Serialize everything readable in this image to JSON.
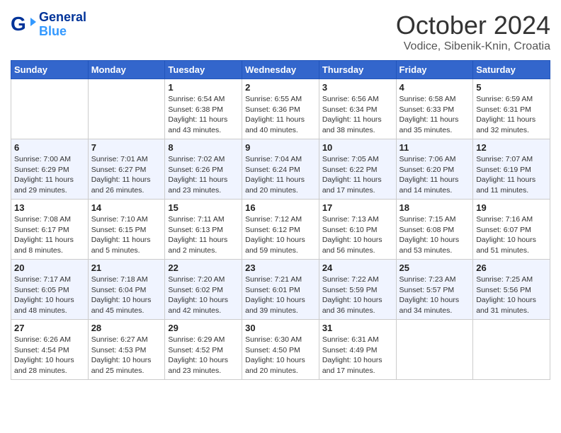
{
  "header": {
    "logo_line1": "General",
    "logo_line2": "Blue",
    "month": "October 2024",
    "location": "Vodice, Sibenik-Knin, Croatia"
  },
  "days_of_week": [
    "Sunday",
    "Monday",
    "Tuesday",
    "Wednesday",
    "Thursday",
    "Friday",
    "Saturday"
  ],
  "weeks": [
    [
      {
        "day": "",
        "sunrise": "",
        "sunset": "",
        "daylight": ""
      },
      {
        "day": "",
        "sunrise": "",
        "sunset": "",
        "daylight": ""
      },
      {
        "day": "1",
        "sunrise": "Sunrise: 6:54 AM",
        "sunset": "Sunset: 6:38 PM",
        "daylight": "Daylight: 11 hours and 43 minutes."
      },
      {
        "day": "2",
        "sunrise": "Sunrise: 6:55 AM",
        "sunset": "Sunset: 6:36 PM",
        "daylight": "Daylight: 11 hours and 40 minutes."
      },
      {
        "day": "3",
        "sunrise": "Sunrise: 6:56 AM",
        "sunset": "Sunset: 6:34 PM",
        "daylight": "Daylight: 11 hours and 38 minutes."
      },
      {
        "day": "4",
        "sunrise": "Sunrise: 6:58 AM",
        "sunset": "Sunset: 6:33 PM",
        "daylight": "Daylight: 11 hours and 35 minutes."
      },
      {
        "day": "5",
        "sunrise": "Sunrise: 6:59 AM",
        "sunset": "Sunset: 6:31 PM",
        "daylight": "Daylight: 11 hours and 32 minutes."
      }
    ],
    [
      {
        "day": "6",
        "sunrise": "Sunrise: 7:00 AM",
        "sunset": "Sunset: 6:29 PM",
        "daylight": "Daylight: 11 hours and 29 minutes."
      },
      {
        "day": "7",
        "sunrise": "Sunrise: 7:01 AM",
        "sunset": "Sunset: 6:27 PM",
        "daylight": "Daylight: 11 hours and 26 minutes."
      },
      {
        "day": "8",
        "sunrise": "Sunrise: 7:02 AM",
        "sunset": "Sunset: 6:26 PM",
        "daylight": "Daylight: 11 hours and 23 minutes."
      },
      {
        "day": "9",
        "sunrise": "Sunrise: 7:04 AM",
        "sunset": "Sunset: 6:24 PM",
        "daylight": "Daylight: 11 hours and 20 minutes."
      },
      {
        "day": "10",
        "sunrise": "Sunrise: 7:05 AM",
        "sunset": "Sunset: 6:22 PM",
        "daylight": "Daylight: 11 hours and 17 minutes."
      },
      {
        "day": "11",
        "sunrise": "Sunrise: 7:06 AM",
        "sunset": "Sunset: 6:20 PM",
        "daylight": "Daylight: 11 hours and 14 minutes."
      },
      {
        "day": "12",
        "sunrise": "Sunrise: 7:07 AM",
        "sunset": "Sunset: 6:19 PM",
        "daylight": "Daylight: 11 hours and 11 minutes."
      }
    ],
    [
      {
        "day": "13",
        "sunrise": "Sunrise: 7:08 AM",
        "sunset": "Sunset: 6:17 PM",
        "daylight": "Daylight: 11 hours and 8 minutes."
      },
      {
        "day": "14",
        "sunrise": "Sunrise: 7:10 AM",
        "sunset": "Sunset: 6:15 PM",
        "daylight": "Daylight: 11 hours and 5 minutes."
      },
      {
        "day": "15",
        "sunrise": "Sunrise: 7:11 AM",
        "sunset": "Sunset: 6:13 PM",
        "daylight": "Daylight: 11 hours and 2 minutes."
      },
      {
        "day": "16",
        "sunrise": "Sunrise: 7:12 AM",
        "sunset": "Sunset: 6:12 PM",
        "daylight": "Daylight: 10 hours and 59 minutes."
      },
      {
        "day": "17",
        "sunrise": "Sunrise: 7:13 AM",
        "sunset": "Sunset: 6:10 PM",
        "daylight": "Daylight: 10 hours and 56 minutes."
      },
      {
        "day": "18",
        "sunrise": "Sunrise: 7:15 AM",
        "sunset": "Sunset: 6:08 PM",
        "daylight": "Daylight: 10 hours and 53 minutes."
      },
      {
        "day": "19",
        "sunrise": "Sunrise: 7:16 AM",
        "sunset": "Sunset: 6:07 PM",
        "daylight": "Daylight: 10 hours and 51 minutes."
      }
    ],
    [
      {
        "day": "20",
        "sunrise": "Sunrise: 7:17 AM",
        "sunset": "Sunset: 6:05 PM",
        "daylight": "Daylight: 10 hours and 48 minutes."
      },
      {
        "day": "21",
        "sunrise": "Sunrise: 7:18 AM",
        "sunset": "Sunset: 6:04 PM",
        "daylight": "Daylight: 10 hours and 45 minutes."
      },
      {
        "day": "22",
        "sunrise": "Sunrise: 7:20 AM",
        "sunset": "Sunset: 6:02 PM",
        "daylight": "Daylight: 10 hours and 42 minutes."
      },
      {
        "day": "23",
        "sunrise": "Sunrise: 7:21 AM",
        "sunset": "Sunset: 6:01 PM",
        "daylight": "Daylight: 10 hours and 39 minutes."
      },
      {
        "day": "24",
        "sunrise": "Sunrise: 7:22 AM",
        "sunset": "Sunset: 5:59 PM",
        "daylight": "Daylight: 10 hours and 36 minutes."
      },
      {
        "day": "25",
        "sunrise": "Sunrise: 7:23 AM",
        "sunset": "Sunset: 5:57 PM",
        "daylight": "Daylight: 10 hours and 34 minutes."
      },
      {
        "day": "26",
        "sunrise": "Sunrise: 7:25 AM",
        "sunset": "Sunset: 5:56 PM",
        "daylight": "Daylight: 10 hours and 31 minutes."
      }
    ],
    [
      {
        "day": "27",
        "sunrise": "Sunrise: 6:26 AM",
        "sunset": "Sunset: 4:54 PM",
        "daylight": "Daylight: 10 hours and 28 minutes."
      },
      {
        "day": "28",
        "sunrise": "Sunrise: 6:27 AM",
        "sunset": "Sunset: 4:53 PM",
        "daylight": "Daylight: 10 hours and 25 minutes."
      },
      {
        "day": "29",
        "sunrise": "Sunrise: 6:29 AM",
        "sunset": "Sunset: 4:52 PM",
        "daylight": "Daylight: 10 hours and 23 minutes."
      },
      {
        "day": "30",
        "sunrise": "Sunrise: 6:30 AM",
        "sunset": "Sunset: 4:50 PM",
        "daylight": "Daylight: 10 hours and 20 minutes."
      },
      {
        "day": "31",
        "sunrise": "Sunrise: 6:31 AM",
        "sunset": "Sunset: 4:49 PM",
        "daylight": "Daylight: 10 hours and 17 minutes."
      },
      {
        "day": "",
        "sunrise": "",
        "sunset": "",
        "daylight": ""
      },
      {
        "day": "",
        "sunrise": "",
        "sunset": "",
        "daylight": ""
      }
    ]
  ]
}
